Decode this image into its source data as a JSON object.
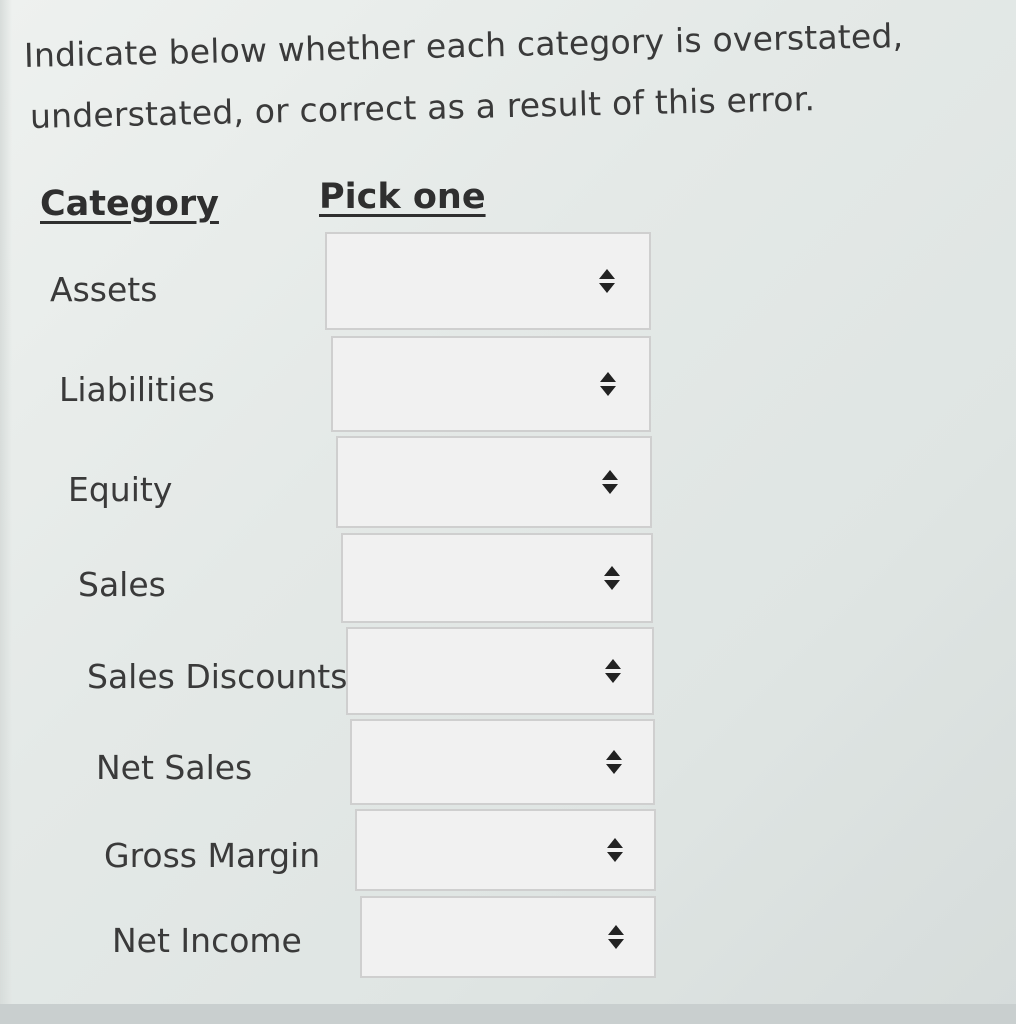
{
  "instructions": {
    "line1": "Indicate below whether each category is overstated,",
    "line2": "understated, or correct as a result of this error."
  },
  "table": {
    "category_header": "Category",
    "pick_header": "Pick one",
    "rows": [
      {
        "label": "Assets",
        "selected": ""
      },
      {
        "label": "Liabilities",
        "selected": ""
      },
      {
        "label": "Equity",
        "selected": ""
      },
      {
        "label": "Sales",
        "selected": ""
      },
      {
        "label": "Sales Discounts",
        "selected": ""
      },
      {
        "label": "Net Sales",
        "selected": ""
      },
      {
        "label": "Gross Margin",
        "selected": ""
      },
      {
        "label": "Net Income",
        "selected": ""
      }
    ]
  },
  "icons": {
    "select_arrow": "up-down-chevron-icon"
  }
}
